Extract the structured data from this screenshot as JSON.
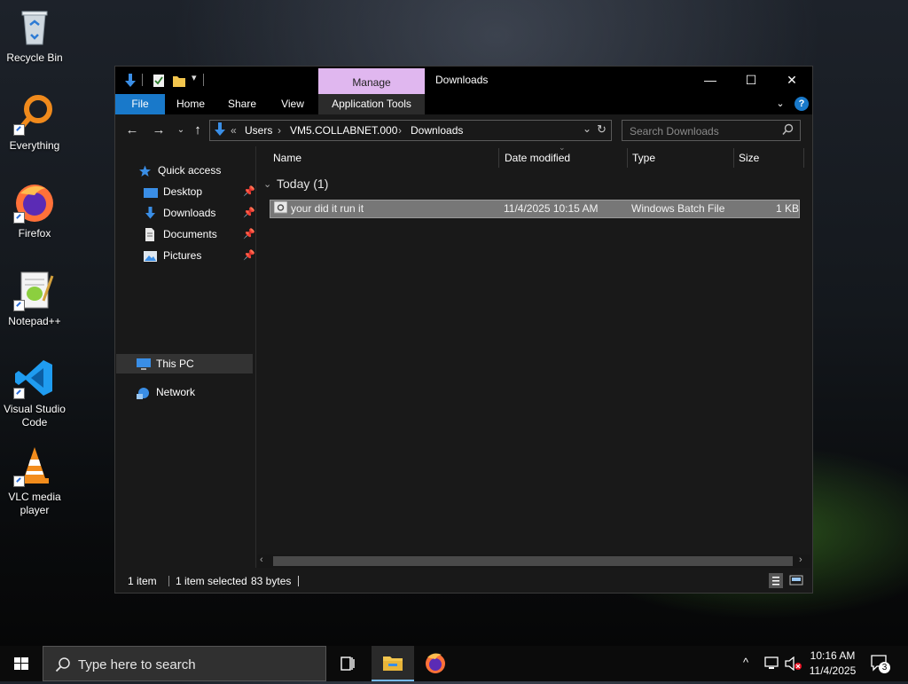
{
  "desktop": {
    "icons": [
      {
        "label": "Recycle Bin"
      },
      {
        "label": "Everything"
      },
      {
        "label": "Firefox"
      },
      {
        "label": "Notepad++"
      },
      {
        "label": "Visual Studio Code"
      },
      {
        "label": "VLC media player"
      }
    ]
  },
  "window": {
    "title": "Downloads",
    "context_tab": "Manage",
    "ribbon_tabs": [
      "File",
      "Home",
      "Share",
      "View",
      "Application Tools"
    ],
    "controls": {
      "minimize": "—",
      "maximize": "☐",
      "close": "✕"
    },
    "help": "?"
  },
  "address": {
    "overflow": "«",
    "crumbs": [
      "Users",
      "VM5.COLLABNET.000",
      "Downloads"
    ],
    "separator": "›"
  },
  "search": {
    "placeholder": "Search Downloads"
  },
  "nav_pane": {
    "quick_access": "Quick access",
    "quick_items": [
      {
        "label": "Desktop",
        "pinned": true
      },
      {
        "label": "Downloads",
        "pinned": true
      },
      {
        "label": "Documents",
        "pinned": true
      },
      {
        "label": "Pictures",
        "pinned": true
      }
    ],
    "this_pc": "This PC",
    "network": "Network"
  },
  "file_list": {
    "columns": [
      "Name",
      "Date modified",
      "Type",
      "Size"
    ],
    "group": "Today (1)",
    "rows": [
      {
        "name": "your did it run it",
        "date": "11/4/2025 10:15 AM",
        "type": "Windows Batch File",
        "size": "1 KB"
      }
    ]
  },
  "status": {
    "item_count": "1 item",
    "selection": "1 item selected",
    "selection_size": "83 bytes"
  },
  "taskbar": {
    "search_placeholder": "Type here to search",
    "time": "10:16 AM",
    "date": "11/4/2025",
    "notification_count": "3"
  },
  "colors": {
    "accent": "#1979ca",
    "manage_tab": "#e0b7ef",
    "selected_row": "#777777"
  }
}
